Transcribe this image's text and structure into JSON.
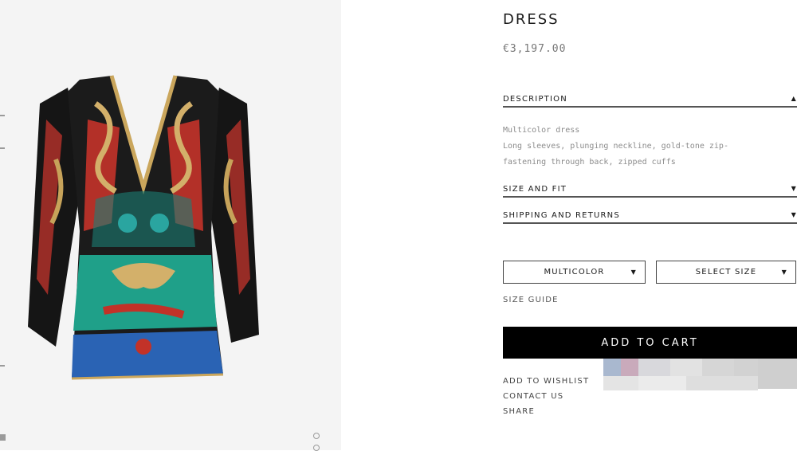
{
  "product": {
    "title": "DRESS",
    "price": "€3,197.00"
  },
  "accordion": {
    "description": {
      "label": "DESCRIPTION",
      "lines": [
        "Multicolor dress",
        "Long sleeves, plunging neckline, gold-tone zip-",
        "fastening through back, zipped cuffs"
      ],
      "icon": "caret-up-icon"
    },
    "size_fit": {
      "label": "SIZE AND FIT",
      "icon": "caret-down-icon"
    },
    "shipping": {
      "label": "SHIPPING AND RETURNS",
      "icon": "caret-down-icon"
    }
  },
  "selectors": {
    "color": {
      "value": "MULTICOLOR",
      "icon": "caret-down-icon"
    },
    "size": {
      "value": "SELECT SIZE",
      "icon": "caret-down-icon"
    }
  },
  "links": {
    "size_guide": "SIZE GUIDE",
    "wishlist": "ADD TO WISHLIST",
    "contact": "CONTACT US",
    "share": "SHARE"
  },
  "cart": {
    "label": "ADD TO CART"
  },
  "colors": {
    "panel_bg": "#f4f4f4",
    "button_bg": "#000000",
    "button_text": "#ffffff"
  }
}
